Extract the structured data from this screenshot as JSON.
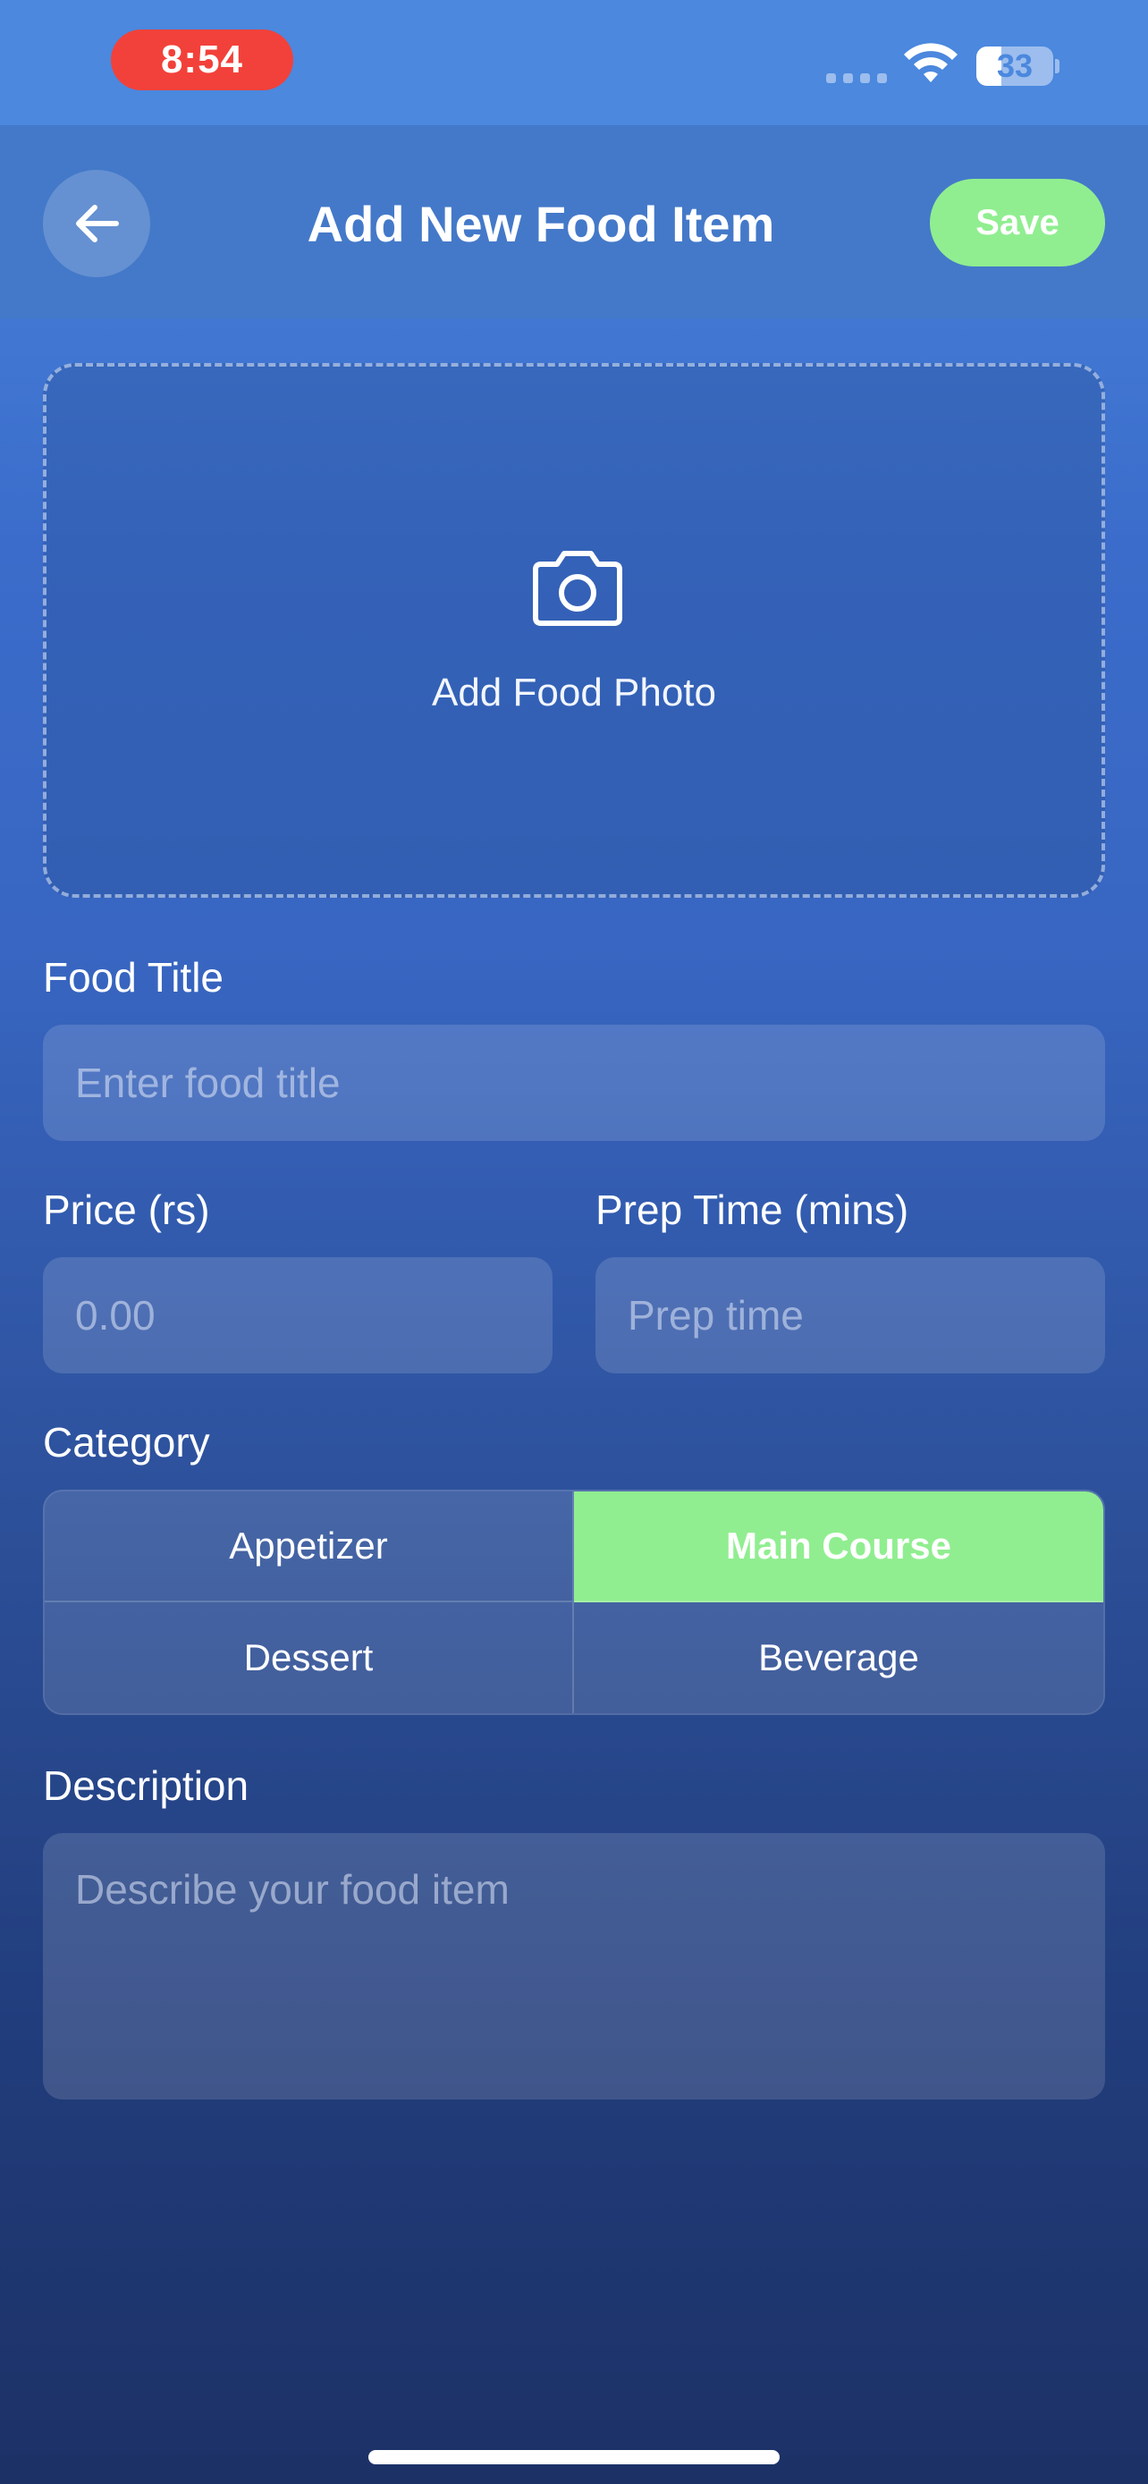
{
  "status_bar": {
    "time": "8:54",
    "battery_level": "33",
    "battery_fraction": 0.33
  },
  "header": {
    "title": "Add New Food Item",
    "save_label": "Save"
  },
  "photo": {
    "label": "Add Food Photo"
  },
  "form": {
    "title_label": "Food Title",
    "title_placeholder": "Enter food title",
    "price_label": "Price (rs)",
    "price_placeholder": "0.00",
    "prep_label": "Prep Time (mins)",
    "prep_placeholder": "Prep time",
    "category_label": "Category",
    "categories": [
      "Appetizer",
      "Main Course",
      "Dessert",
      "Beverage"
    ],
    "selected_category": "Main Course",
    "description_label": "Description",
    "description_placeholder": "Describe your food item"
  },
  "colors": {
    "accent_green": "#90ee90",
    "time_pill_red": "#f2413a",
    "header_blue": "#4479c9"
  }
}
